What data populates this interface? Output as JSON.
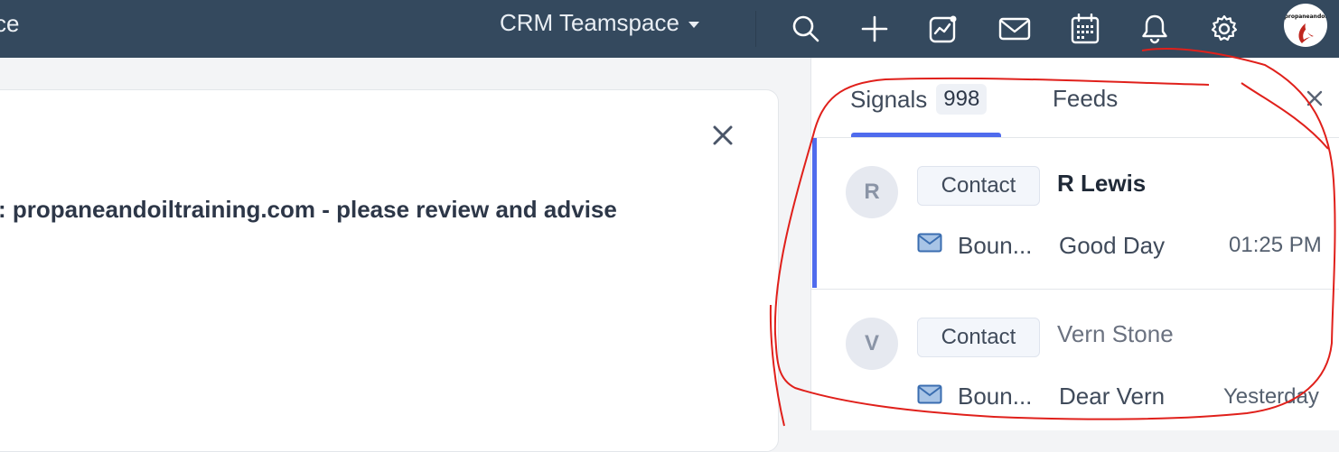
{
  "header": {
    "app_title_fragment": "ce",
    "teamspace_label": "CRM Teamspace",
    "icons": [
      "search-icon",
      "plus-icon",
      "activity-icon",
      "mail-icon",
      "calendar-icon",
      "bell-icon",
      "gear-icon",
      "profile-avatar"
    ],
    "avatar_text": "propaneandoi"
  },
  "main": {
    "subject_fragment": ": propaneandoiltraining.com - please review and advise"
  },
  "panel": {
    "tabs": [
      {
        "label": "Signals",
        "count": "998"
      },
      {
        "label": "Feeds"
      }
    ],
    "signals": [
      {
        "initial": "R",
        "tag": "Contact",
        "name": "R Lewis",
        "type": "Boun...",
        "subject": "Good Day",
        "time": "01:25 PM"
      },
      {
        "initial": "V",
        "tag": "Contact",
        "name": "Vern Stone",
        "type": "Boun...",
        "subject": "Dear Vern",
        "time": "Yesterday"
      }
    ]
  },
  "colors": {
    "topbar": "#34495e",
    "accent": "#4f6bed",
    "annotation": "#e0201b"
  }
}
